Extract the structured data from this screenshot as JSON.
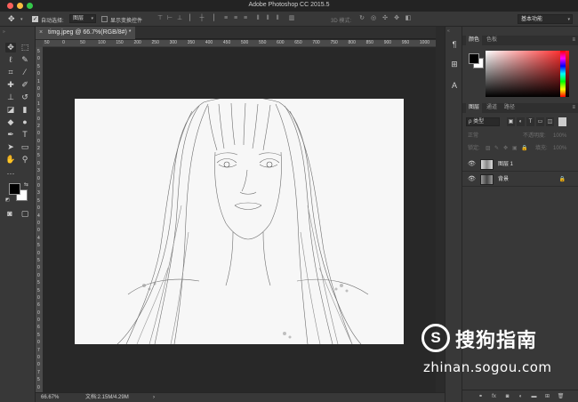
{
  "window": {
    "title": "Adobe Photoshop CC 2015.5"
  },
  "options_bar": {
    "auto_select_label": "自动选择:",
    "auto_select_checked": true,
    "target_value": "图层",
    "transform_controls_label": "显示变换控件",
    "transform_controls_checked": false,
    "mode_3d_label": "3D 模式:",
    "workspace_value": "基本功能"
  },
  "document": {
    "tab_title": "timg.jpeg @ 66.7%(RGB/8#) *",
    "ruler_ticks": [
      "50",
      "0",
      "50",
      "100",
      "150",
      "200",
      "250",
      "300",
      "350",
      "400",
      "450",
      "500",
      "550",
      "600",
      "650",
      "700",
      "750",
      "800",
      "850",
      "900",
      "950",
      "1000"
    ],
    "ruler_v_ticks": [
      "5",
      "0",
      "5",
      "0",
      "1",
      "0",
      "0",
      "1",
      "5",
      "0",
      "2",
      "0",
      "0",
      "2",
      "5",
      "0",
      "3",
      "0",
      "0",
      "3",
      "5",
      "0",
      "4",
      "0",
      "0",
      "4",
      "5",
      "0",
      "5",
      "0",
      "0",
      "5",
      "5",
      "0",
      "6",
      "0",
      "0",
      "6",
      "5",
      "0",
      "7",
      "0",
      "0",
      "7",
      "5",
      "0"
    ]
  },
  "status_bar": {
    "zoom": "66.67%",
    "doc_size": "文档:2.15M/4.29M",
    "arrow": "›"
  },
  "color_panel": {
    "tab_swatch_label": "颜色",
    "tab_palette_label": "色板",
    "foreground": "#000000",
    "background": "#ffffff",
    "menu_icon": "≡"
  },
  "layers_panel": {
    "tabs": [
      "图层",
      "通道",
      "路径"
    ],
    "kind_label": "ρ 类型",
    "blend_mode": "正常",
    "opacity_label": "不透明度:",
    "opacity_value": "100%",
    "lock_label": "锁定:",
    "fill_label": "填充:",
    "fill_value": "100%",
    "layers": [
      {
        "name": "图层 1",
        "visible": true,
        "selected": false,
        "locked": false
      },
      {
        "name": "背景",
        "visible": true,
        "selected": false,
        "locked": true
      }
    ],
    "footer_icons": [
      "link-icon",
      "fx-icon",
      "mask-icon",
      "adjustment-icon",
      "folder-icon",
      "new-layer-icon",
      "trash-icon"
    ]
  },
  "watermark": {
    "symbol": "S",
    "brand": "搜狗指南",
    "url": "zhinan.sogou.com"
  }
}
